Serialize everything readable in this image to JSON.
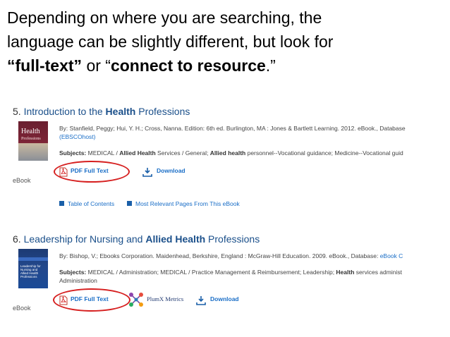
{
  "slide": {
    "line1": "Depending on where you are searching, the",
    "line2": "language can be slightly different, but look for",
    "quote_open": "“",
    "phrase1": "full-text”",
    "or": " or “",
    "phrase2": "connect to resource",
    "quote_close": ".”"
  },
  "results": [
    {
      "number": "5.",
      "title_pre": "Introduction to the ",
      "title_bold": "Health",
      "title_post": " Professions",
      "cover_title": "Health",
      "cover_sub": "Professions",
      "format": "eBook",
      "byline": "By: Stanfield, Peggy; Hui, Y. H.; Cross, Nanna. Edition: 6th ed. Burlington, MA : Jones & Bartlett Learning. 2012. eBook., Database",
      "db_link": "(EBSCOhost)",
      "subjects_label": "Subjects:",
      "subjects_a": " MEDICAL / ",
      "subjects_b": "Allied Health",
      "subjects_c": " Services / General; ",
      "subjects_d": "Allied health",
      "subjects_e": " personnel--Vocational guidance; Medicine--Vocational guid",
      "pdf_label": "PDF Full Text",
      "download_label": "Download",
      "toc_label": "Table of Contents",
      "relevant_label": "Most Relevant Pages From This eBook"
    },
    {
      "number": "6.",
      "title_pre": "Leadership for Nursing and ",
      "title_bold": "Allied Health",
      "title_post": " Professions",
      "cover_title": "Leadership for Nursing and Allied Health Professions",
      "format": "eBook",
      "byline": "By: Bishop, V.; Ebooks Corporation. Maidenhead, Berkshire, England : McGraw-Hill Education. 2009. eBook., Database: ",
      "db_link": "eBook C",
      "subjects_label": "Subjects:",
      "subjects_a": " MEDICAL / Administration; MEDICAL / Practice Management & Reimbursement; Leadership; ",
      "subjects_b": "Health",
      "subjects_c": " services administ",
      "subjects_line2": "Administration",
      "pdf_label": "PDF Full Text",
      "plumx_label": "PlumX Metrics",
      "download_label": "Download"
    }
  ],
  "colors": {
    "accent": "#1a6ec7",
    "highlight_circle": "#d61f1f"
  },
  "icons": [
    "pdf-icon",
    "download-icon",
    "table-of-contents-icon",
    "relevant-pages-icon",
    "plumx-icon"
  ]
}
